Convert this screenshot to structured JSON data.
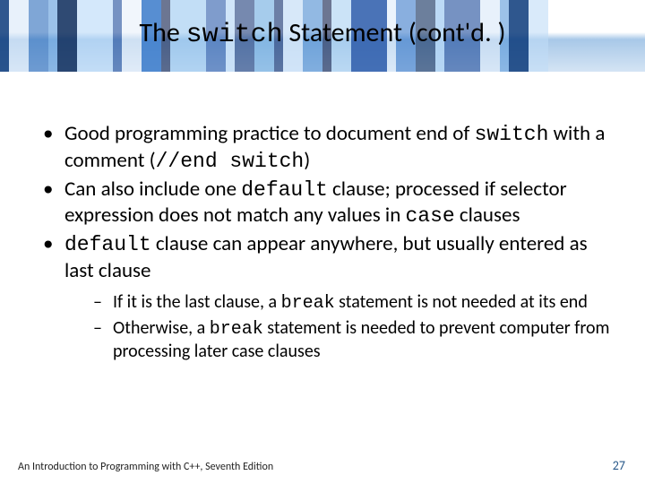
{
  "title": {
    "pre": "The ",
    "code": "switch",
    "post": " Statement (cont'd. )"
  },
  "bullets": [
    {
      "runs": [
        {
          "t": "Good programming practice to document end of "
        },
        {
          "t": "switch",
          "mono": true
        },
        {
          "t": " with a comment ("
        },
        {
          "t": "//end switch",
          "mono": true
        },
        {
          "t": ")"
        }
      ]
    },
    {
      "runs": [
        {
          "t": "Can also include one "
        },
        {
          "t": "default",
          "mono": true
        },
        {
          "t": " clause; processed if selector expression does not match any values in "
        },
        {
          "t": "case",
          "mono": true
        },
        {
          "t": " clauses"
        }
      ]
    },
    {
      "runs": [
        {
          "t": "default",
          "mono": true
        },
        {
          "t": " clause can appear anywhere, but usually entered as last clause"
        }
      ],
      "sub": [
        {
          "runs": [
            {
              "t": "If it is the last clause, a "
            },
            {
              "t": "break",
              "mono": true
            },
            {
              "t": " statement is not needed at its end"
            }
          ]
        },
        {
          "runs": [
            {
              "t": "Otherwise, a "
            },
            {
              "t": "break",
              "mono": true
            },
            {
              "t": " statement is needed to prevent computer from processing later case clauses"
            }
          ]
        }
      ]
    }
  ],
  "footer": {
    "left": "An Introduction to Programming with C++, Seventh Edition",
    "right": "27"
  },
  "banner_colors": [
    "#0a3a7a",
    "#d8e8f8",
    "#2a6aba",
    "#5a9ada",
    "#0a2a5a",
    "#b8d8f8",
    "#1a4a9a",
    "#e8f0fa",
    "#3a7aca",
    "#0a1a4a",
    "#9ac8f0",
    "#2a5aaa",
    "#c8e0f8",
    "#1a3a7a",
    "#6aaae0",
    "#0a2a6a",
    "#d0e4f8",
    "#4a8ad0",
    "#0a1a4a",
    "#a8d0f2",
    "#2a5aaa",
    "#e0ecfa",
    "#3a7aca",
    "#0a2a5a",
    "#b0d4f4",
    "#1a4a9a",
    "#d8e8f8",
    "#5a9ada",
    "#0a3a7a",
    "#c0dcf6"
  ]
}
